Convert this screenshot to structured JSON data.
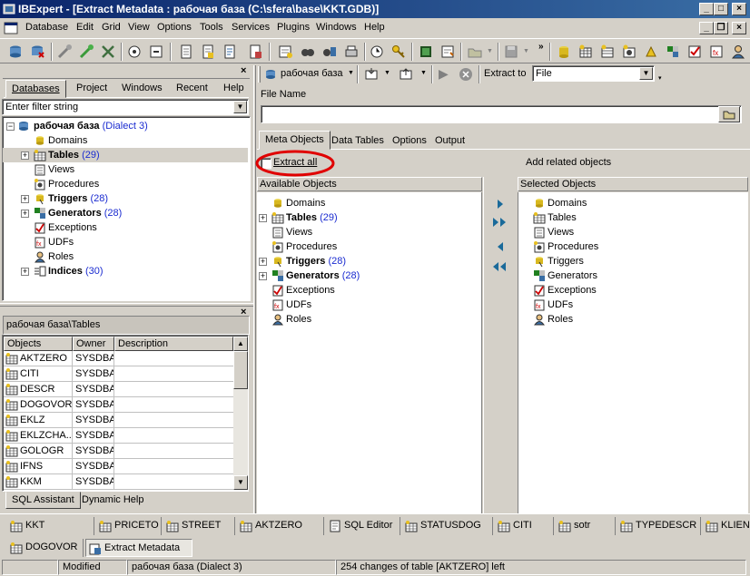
{
  "window": {
    "title": "IBExpert - [Extract Metadata : рабочая база (C:\\sfera\\base\\KKT.GDB)]",
    "minimize": "_",
    "maximize": "□",
    "close": "×"
  },
  "menu": [
    "Database",
    "Edit",
    "Grid",
    "View",
    "Options",
    "Tools",
    "Services",
    "Plugins",
    "Windows",
    "Help"
  ],
  "db_explorer": {
    "tabs": [
      "Databases",
      "Project",
      "Windows",
      "Recent",
      "Help"
    ],
    "filter_placeholder": "Enter filter string",
    "tree": {
      "db_name": "рабочая база",
      "db_dialect": "(Dialect 3)",
      "items": [
        {
          "label": "Domains",
          "count": ""
        },
        {
          "label": "Tables",
          "count": "(29)"
        },
        {
          "label": "Views",
          "count": ""
        },
        {
          "label": "Procedures",
          "count": ""
        },
        {
          "label": "Triggers",
          "count": "(28)"
        },
        {
          "label": "Generators",
          "count": "(28)"
        },
        {
          "label": "Exceptions",
          "count": ""
        },
        {
          "label": "UDFs",
          "count": ""
        },
        {
          "label": "Roles",
          "count": ""
        },
        {
          "label": "Indices",
          "count": "(30)"
        }
      ]
    }
  },
  "object_list": {
    "caption": "рабочая база\\Tables",
    "columns": [
      "Objects",
      "Owner",
      "Description"
    ],
    "rows": [
      {
        "name": "AKTZERO",
        "owner": "SYSDBA"
      },
      {
        "name": "CITI",
        "owner": "SYSDBA"
      },
      {
        "name": "DESCR",
        "owner": "SYSDBA"
      },
      {
        "name": "DOGOVOR",
        "owner": "SYSDBA"
      },
      {
        "name": "EKLZ",
        "owner": "SYSDBA"
      },
      {
        "name": "EKLZCHA...",
        "owner": "SYSDBA"
      },
      {
        "name": "GOLOGR",
        "owner": "SYSDBA"
      },
      {
        "name": "IFNS",
        "owner": "SYSDBA"
      },
      {
        "name": "KKM",
        "owner": "SYSDBA"
      }
    ],
    "bottom_tabs": [
      "SQL Assistant",
      "Dynamic Help"
    ]
  },
  "extract": {
    "db_selector": "рабочая база",
    "extract_to_label": "Extract to",
    "extract_to_value": "File",
    "file_name_label": "File Name",
    "file_name_value": "",
    "tabs": [
      "Meta Objects",
      "Data Tables",
      "Options",
      "Output"
    ],
    "extract_all_label": "Extract all",
    "extract_all_checked": false,
    "add_related_label": "Add related objects",
    "available_header": "Available Objects",
    "selected_header": "Selected Objects",
    "available": [
      {
        "label": "Domains",
        "count": "",
        "bold": false,
        "expandable": false
      },
      {
        "label": "Tables",
        "count": "(29)",
        "bold": true,
        "expandable": true
      },
      {
        "label": "Views",
        "count": "",
        "bold": false,
        "expandable": false
      },
      {
        "label": "Procedures",
        "count": "",
        "bold": false,
        "expandable": false
      },
      {
        "label": "Triggers",
        "count": "(28)",
        "bold": true,
        "expandable": true
      },
      {
        "label": "Generators",
        "count": "(28)",
        "bold": true,
        "expandable": true
      },
      {
        "label": "Exceptions",
        "count": "",
        "bold": false,
        "expandable": false
      },
      {
        "label": "UDFs",
        "count": "",
        "bold": false,
        "expandable": false
      },
      {
        "label": "Roles",
        "count": "",
        "bold": false,
        "expandable": false
      }
    ],
    "selected": [
      "Domains",
      "Tables",
      "Views",
      "Procedures",
      "Triggers",
      "Generators",
      "Exceptions",
      "UDFs",
      "Roles"
    ],
    "move_buttons": [
      "›",
      "»",
      "‹",
      "«"
    ]
  },
  "window_tabs": {
    "row1": [
      "KKT",
      "PRICETO",
      "STREET",
      "AKTZERO",
      "SQL Editor",
      "STATUSDOG",
      "CITI",
      "sotr",
      "TYPEDESCR",
      "KLIENT"
    ],
    "row2": [
      "DOGOVOR",
      "Extract Metadata"
    ]
  },
  "statusbar": {
    "state": "Modified",
    "database": "рабочая база (Dialect 3)",
    "message": "254 changes of table [AKTZERO] left"
  },
  "colors": {
    "title_start": "#0a246a",
    "title_end": "#3a6ea5",
    "count_blue": "#1a2bd0",
    "highlight_ring": "#e00000",
    "face": "#d4d0c8"
  }
}
